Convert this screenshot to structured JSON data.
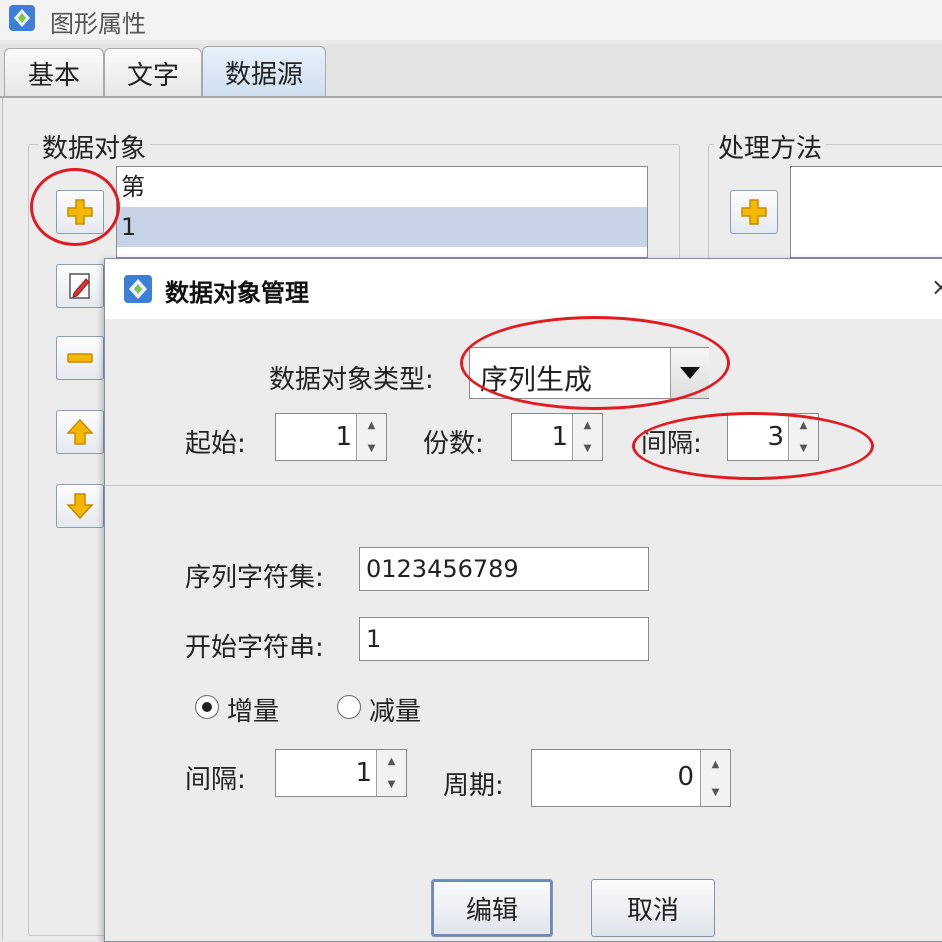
{
  "window": {
    "title": "图形属性"
  },
  "tabs": [
    {
      "label": "基本"
    },
    {
      "label": "文字"
    },
    {
      "label": "数据源",
      "active": true
    }
  ],
  "data_objects": {
    "legend": "数据对象",
    "items": [
      "第",
      "1"
    ],
    "selected_index": 1
  },
  "process_methods": {
    "legend": "处理方法"
  },
  "dialog": {
    "title": "数据对象管理",
    "close_glyph": "×",
    "type_label": "数据对象类型:",
    "type_value": "序列生成",
    "start_label": "起始:",
    "start_value": "1",
    "copies_label": "份数:",
    "copies_value": "1",
    "interval_top_label": "间隔:",
    "interval_top_value": "3",
    "charset_label": "序列字符集:",
    "charset_value": "0123456789",
    "start_string_label": "开始字符串:",
    "start_string_value": "1",
    "increment_label": "增量",
    "decrement_label": "减量",
    "mode_selected": "increment",
    "interval_label": "间隔:",
    "interval_value": "1",
    "period_label": "周期:",
    "period_value": "0",
    "edit_button": "编辑",
    "cancel_button": "取消"
  },
  "colors": {
    "annotation": "#e11b22",
    "selection": "#c7d3e6",
    "icon_yellow": "#f5b800"
  }
}
